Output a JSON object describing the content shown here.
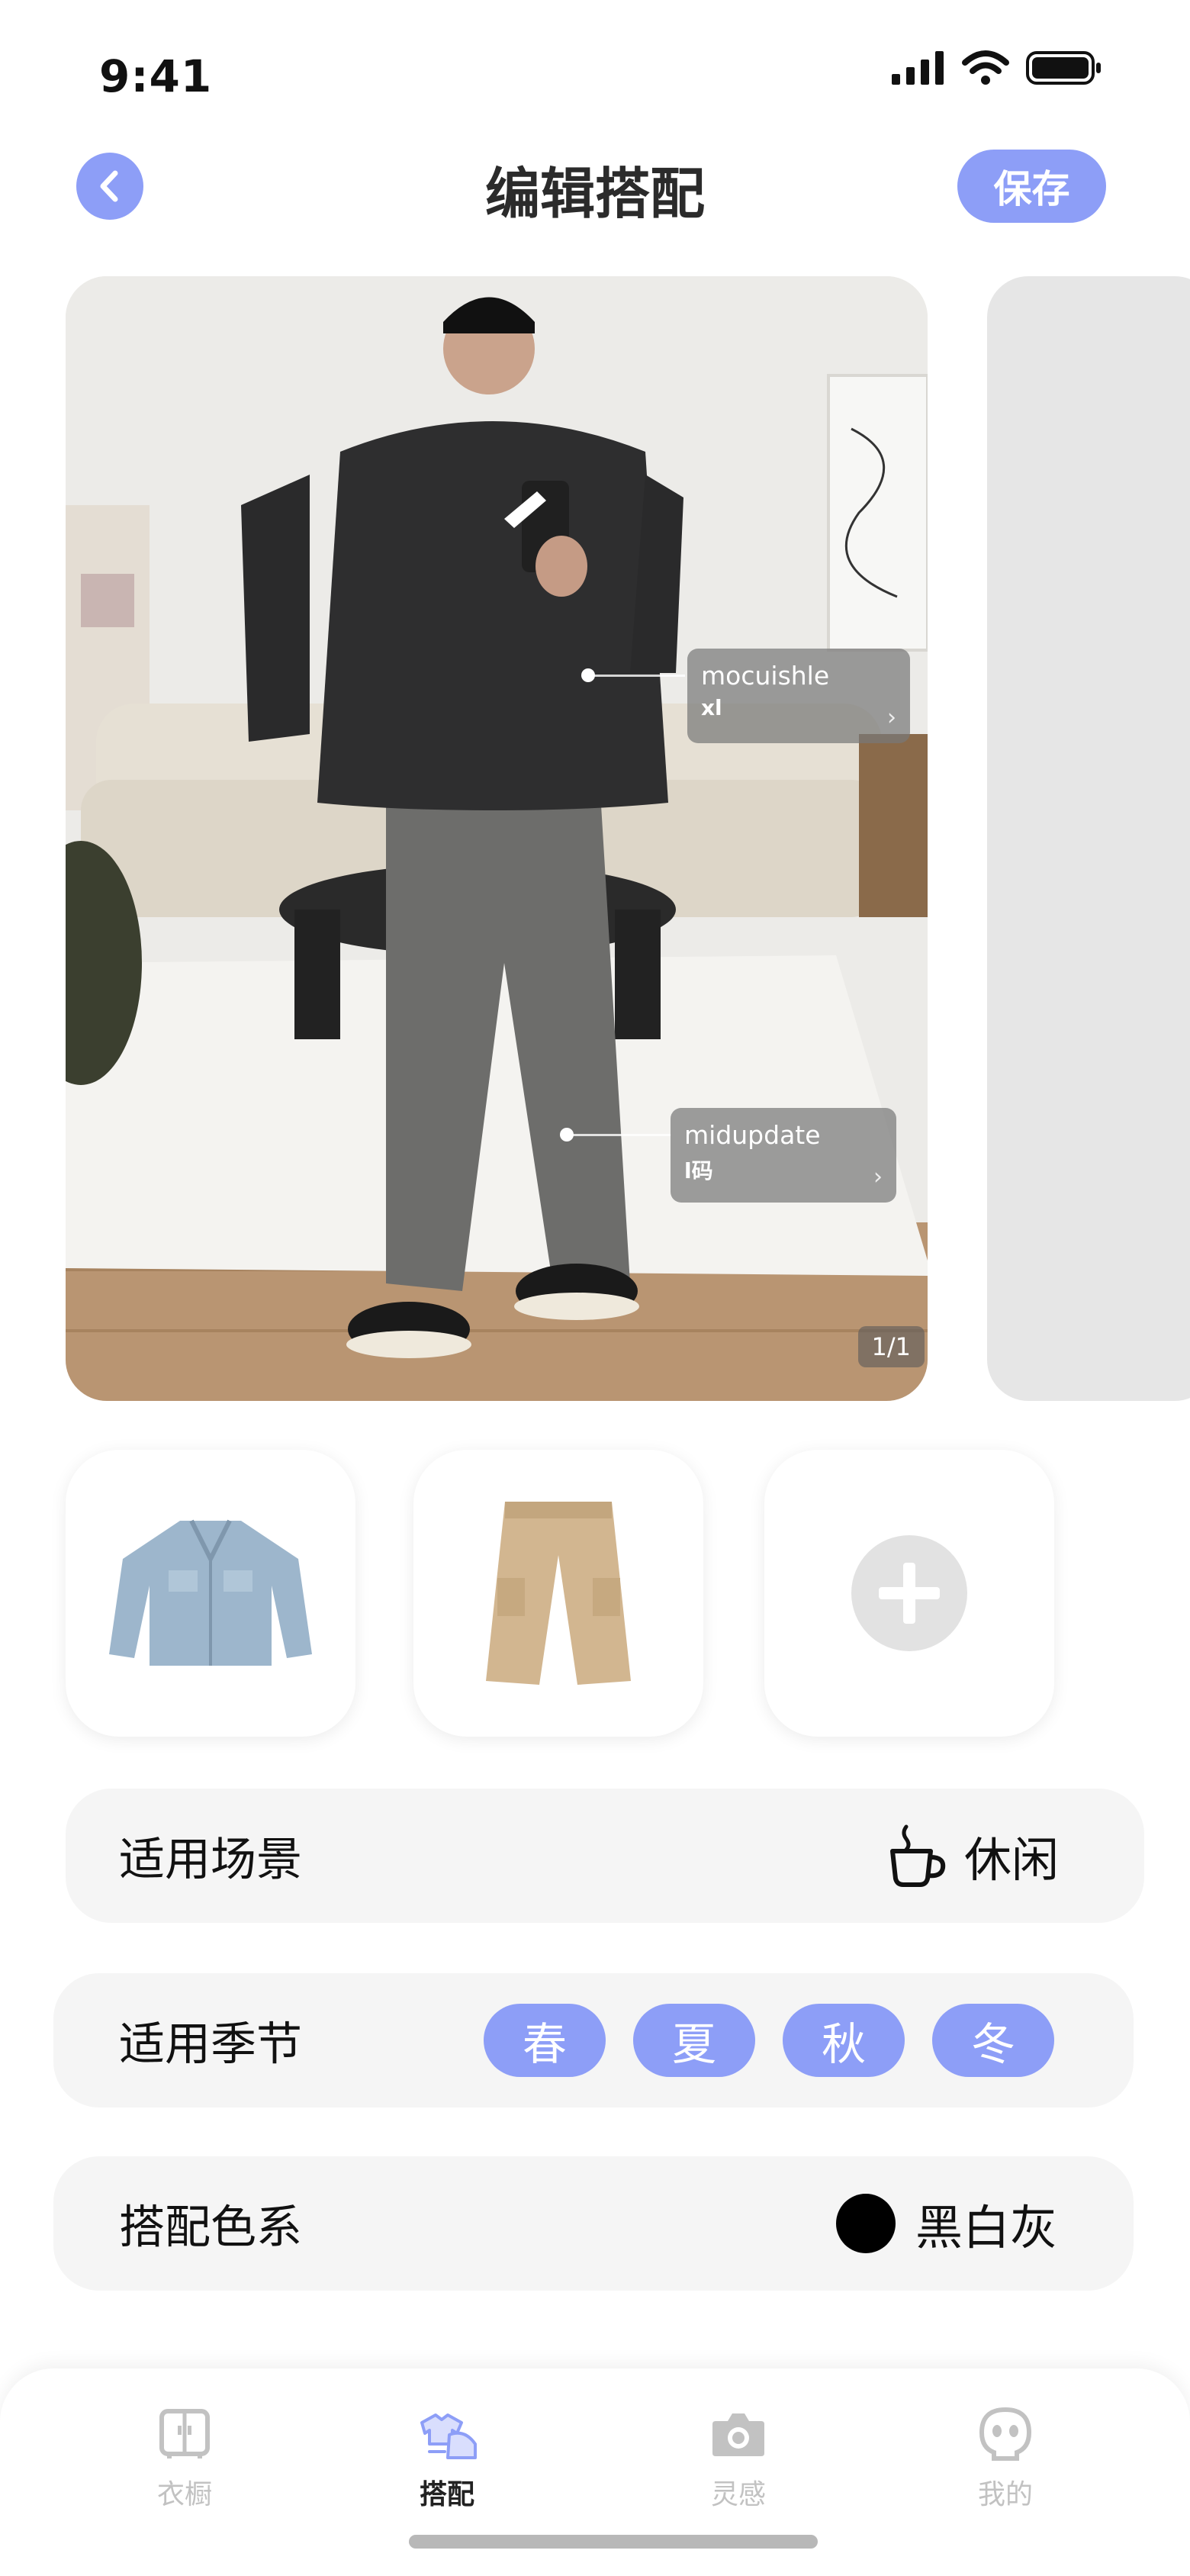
{
  "status_bar": {
    "time": "9:41"
  },
  "header": {
    "title": "编辑搭配",
    "save_label": "保存"
  },
  "photo": {
    "tags": [
      {
        "brand": "mocuishle",
        "size": "xl"
      },
      {
        "brand": "midupdate",
        "size": "l码"
      }
    ],
    "page_indicator": "1/1"
  },
  "items": [
    {
      "name": "denim-jacket"
    },
    {
      "name": "khaki-cargo-pants"
    }
  ],
  "scene": {
    "label": "适用场景",
    "value": "休闲",
    "icon": "coffee-cup-icon"
  },
  "season": {
    "label": "适用季节",
    "options": [
      "春",
      "夏",
      "秋",
      "冬"
    ]
  },
  "color": {
    "label": "搭配色系",
    "value": "黑白灰",
    "swatch": "#000000"
  },
  "tabbar": {
    "tabs": [
      {
        "label": "衣橱",
        "icon": "wardrobe-icon"
      },
      {
        "label": "搭配",
        "icon": "outfit-icon",
        "active": true
      },
      {
        "label": "灵感",
        "icon": "camera-icon"
      },
      {
        "label": "我的",
        "icon": "profile-icon"
      }
    ]
  },
  "colors": {
    "accent": "#8d9ef7",
    "row_bg": "#f5f5f5",
    "inactive": "#c2c2c2"
  }
}
